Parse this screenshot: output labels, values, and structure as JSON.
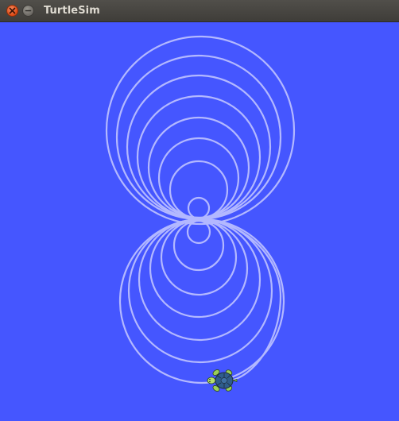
{
  "window": {
    "title": "TurtleSim"
  },
  "canvas": {
    "background_color": "#4556ff",
    "pen_color": "#b3b8ff"
  },
  "icons": {
    "close": "close-icon",
    "minimize": "minimize-icon",
    "turtle": "turtle-icon"
  }
}
